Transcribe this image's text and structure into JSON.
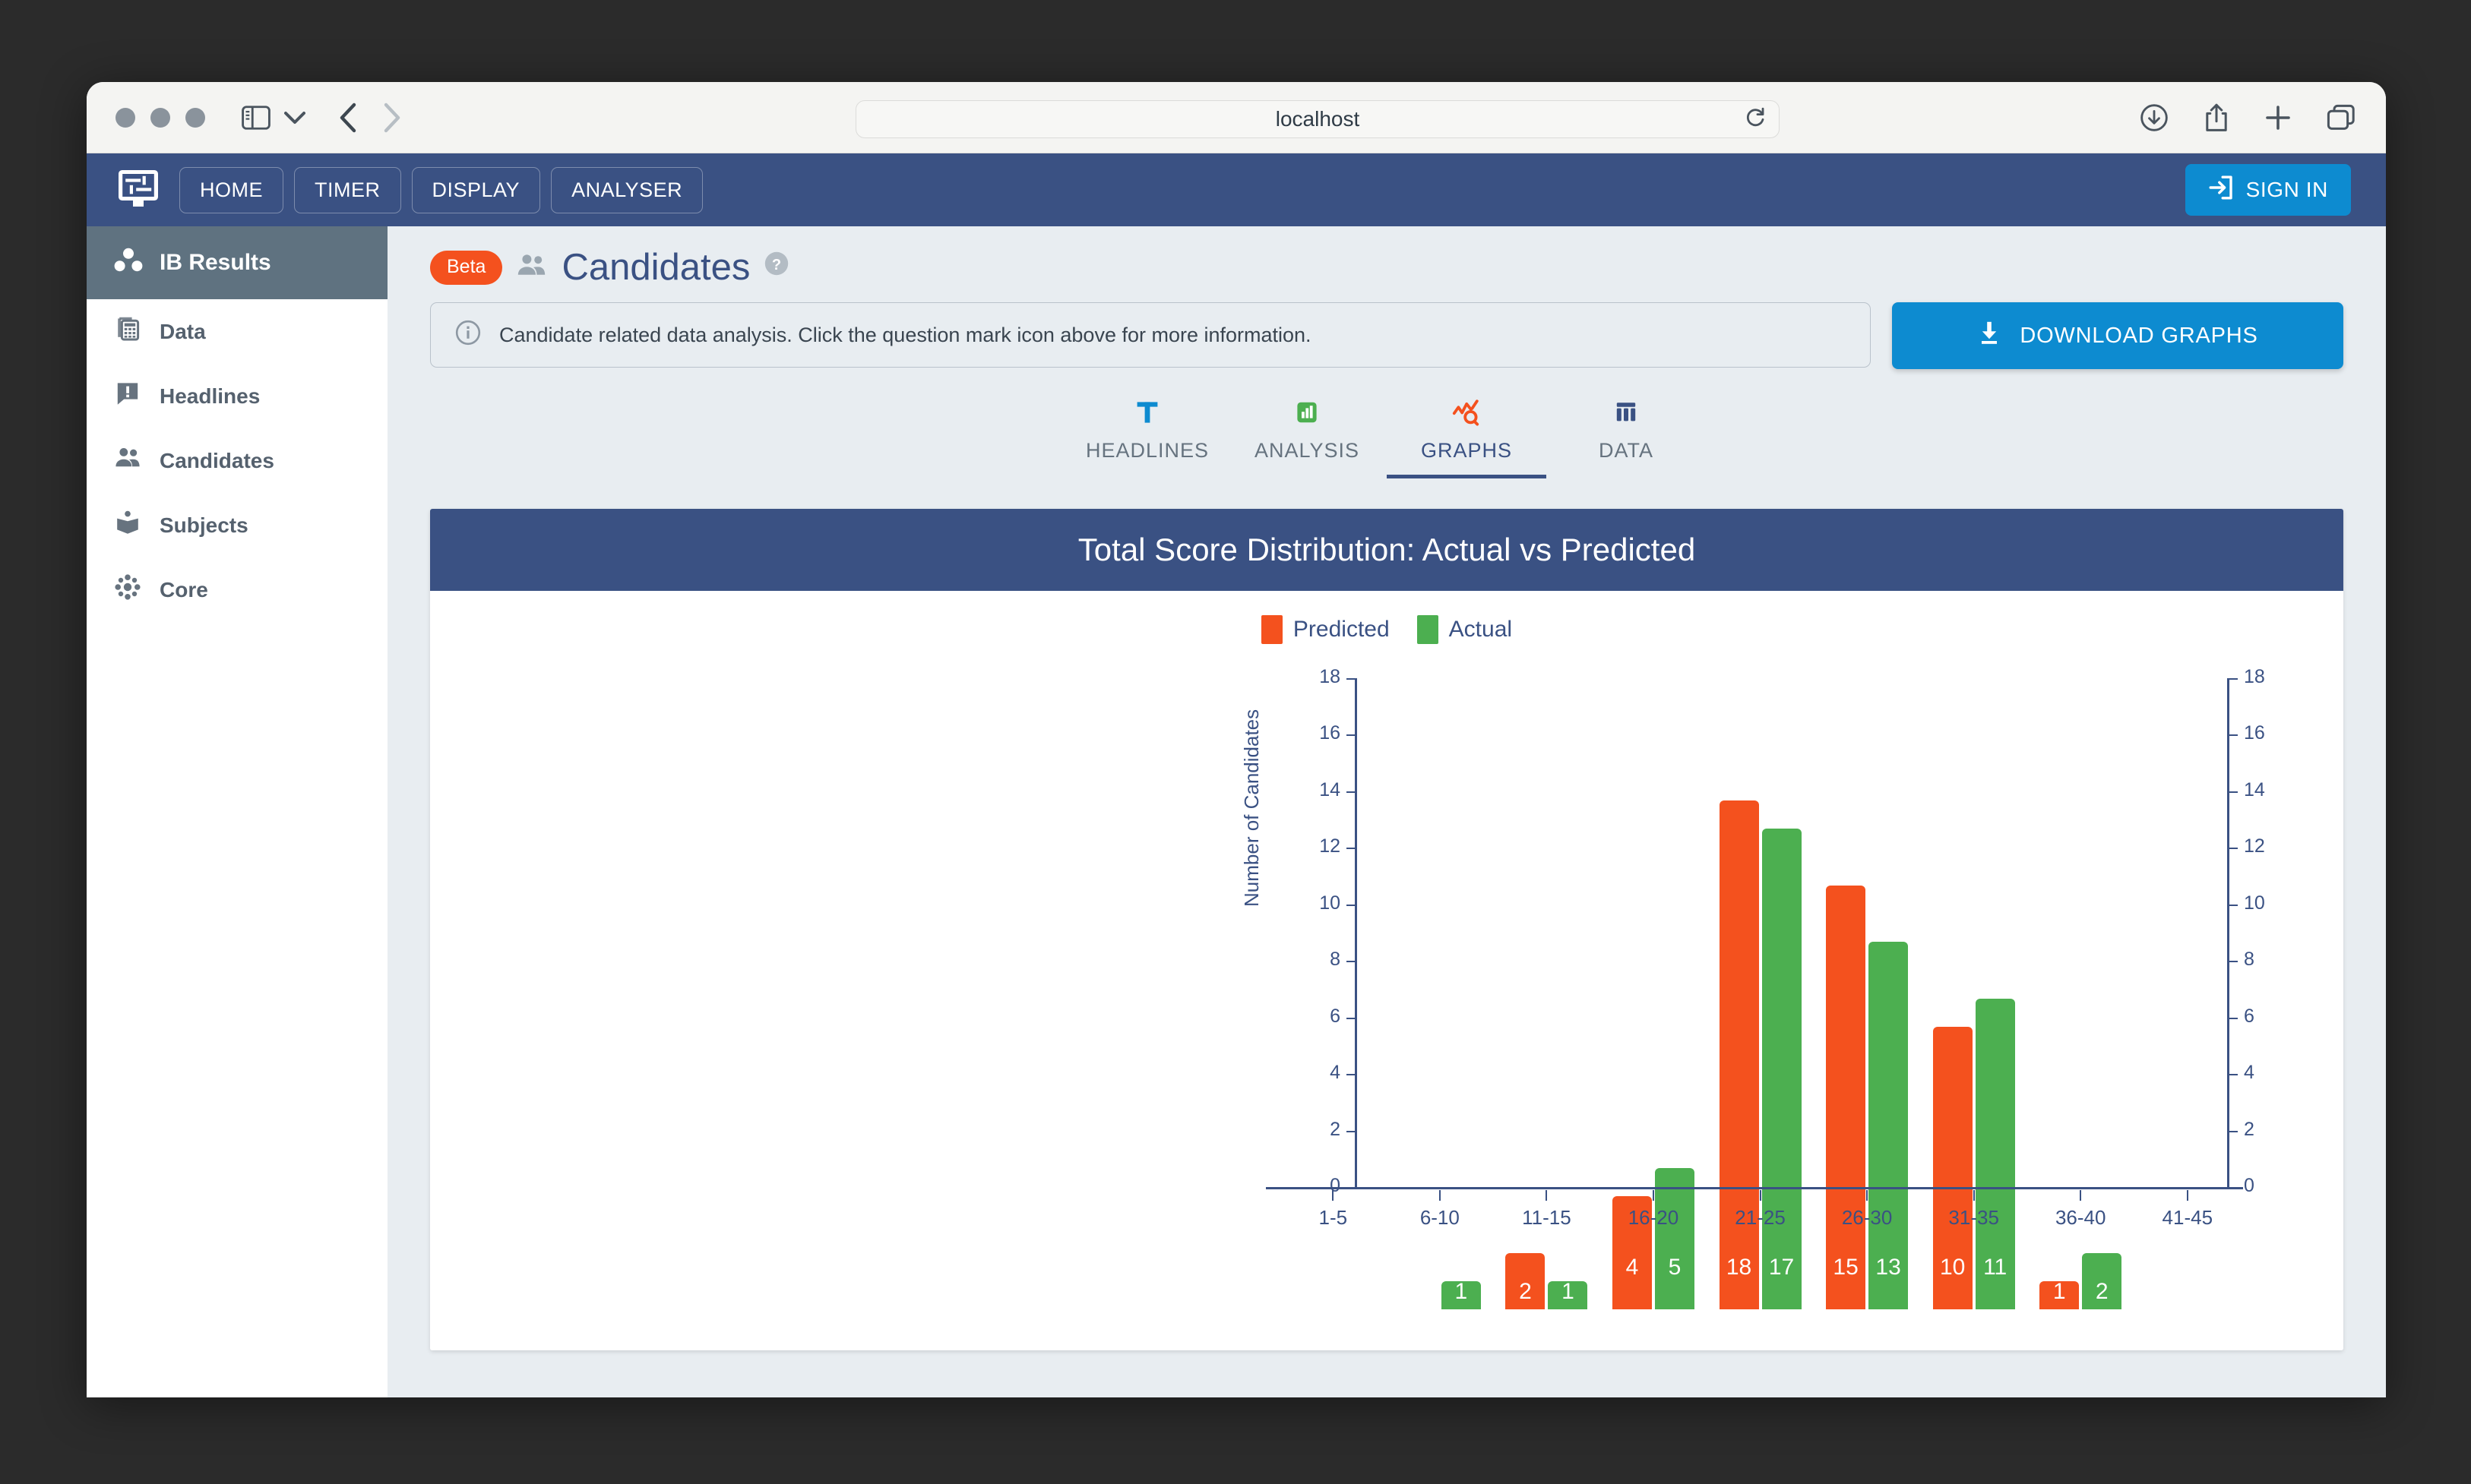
{
  "browser": {
    "url": "localhost",
    "icons": {
      "sidebar": "sidebar-toggle-icon",
      "chevron": "chevron-down-icon",
      "back": "back-arrow-icon",
      "forward": "forward-arrow-icon",
      "reload": "reload-icon",
      "downloads": "downloads-icon",
      "share": "share-icon",
      "newtab": "new-tab-icon",
      "tabs": "tab-overview-icon"
    }
  },
  "appbar": {
    "logo": "analyser-logo-icon",
    "nav": [
      {
        "label": "HOME"
      },
      {
        "label": "TIMER"
      },
      {
        "label": "DISPLAY"
      },
      {
        "label": "ANALYSER"
      }
    ],
    "signin": {
      "label": "SIGN IN",
      "icon": "login-icon",
      "color": "#0d8bd0"
    }
  },
  "sidebar": {
    "header": {
      "label": "IB Results",
      "icon": "results-dots-icon"
    },
    "items": [
      {
        "label": "Data",
        "icon": "calculator-icon"
      },
      {
        "label": "Headlines",
        "icon": "alert-bubble-icon"
      },
      {
        "label": "Candidates",
        "icon": "people-icon"
      },
      {
        "label": "Subjects",
        "icon": "book-icon"
      },
      {
        "label": "Core",
        "icon": "hub-icon"
      }
    ]
  },
  "page": {
    "badge": "Beta",
    "title": "Candidates",
    "title_icon": "people-icon",
    "help_icon": "help-circle-icon",
    "note": {
      "icon": "info-icon",
      "text": "Candidate related data analysis. Click the question mark icon above for more information."
    },
    "download_button": {
      "label": "DOWNLOAD GRAPHS",
      "icon": "download-icon"
    }
  },
  "tabs": [
    {
      "label": "HEADLINES",
      "icon": "text-t-icon",
      "active": false
    },
    {
      "label": "ANALYSIS",
      "icon": "bar-chart-square-icon",
      "active": false
    },
    {
      "label": "GRAPHS",
      "icon": "graph-search-icon",
      "active": true
    },
    {
      "label": "DATA",
      "icon": "table-columns-icon",
      "active": false
    }
  ],
  "colors": {
    "navy": "#3a5183",
    "orange": "#f4511e",
    "green": "#4caf50",
    "blue": "#0d8bd0"
  },
  "chart_data": {
    "type": "bar",
    "title": "Total Score Distribution: Actual vs Predicted",
    "xlabel": "",
    "ylabel": "Number of Candidates",
    "ylim": [
      0,
      18
    ],
    "yticks": [
      0,
      2,
      4,
      6,
      8,
      10,
      12,
      14,
      16,
      18
    ],
    "right_axis": true,
    "right_yticks": [
      0,
      2,
      4,
      6,
      8,
      10,
      12,
      14,
      16,
      18
    ],
    "grid": false,
    "legend_position": "top-center",
    "categories": [
      "1-5",
      "6-10",
      "11-15",
      "16-20",
      "21-25",
      "26-30",
      "31-35",
      "36-40",
      "41-45"
    ],
    "series": [
      {
        "name": "Predicted",
        "color": "#f4511e",
        "values": [
          0,
          0,
          2,
          4,
          18,
          15,
          10,
          1,
          0
        ]
      },
      {
        "name": "Actual",
        "color": "#4caf50",
        "values": [
          0,
          1,
          1,
          5,
          17,
          13,
          11,
          2,
          0
        ]
      }
    ]
  }
}
